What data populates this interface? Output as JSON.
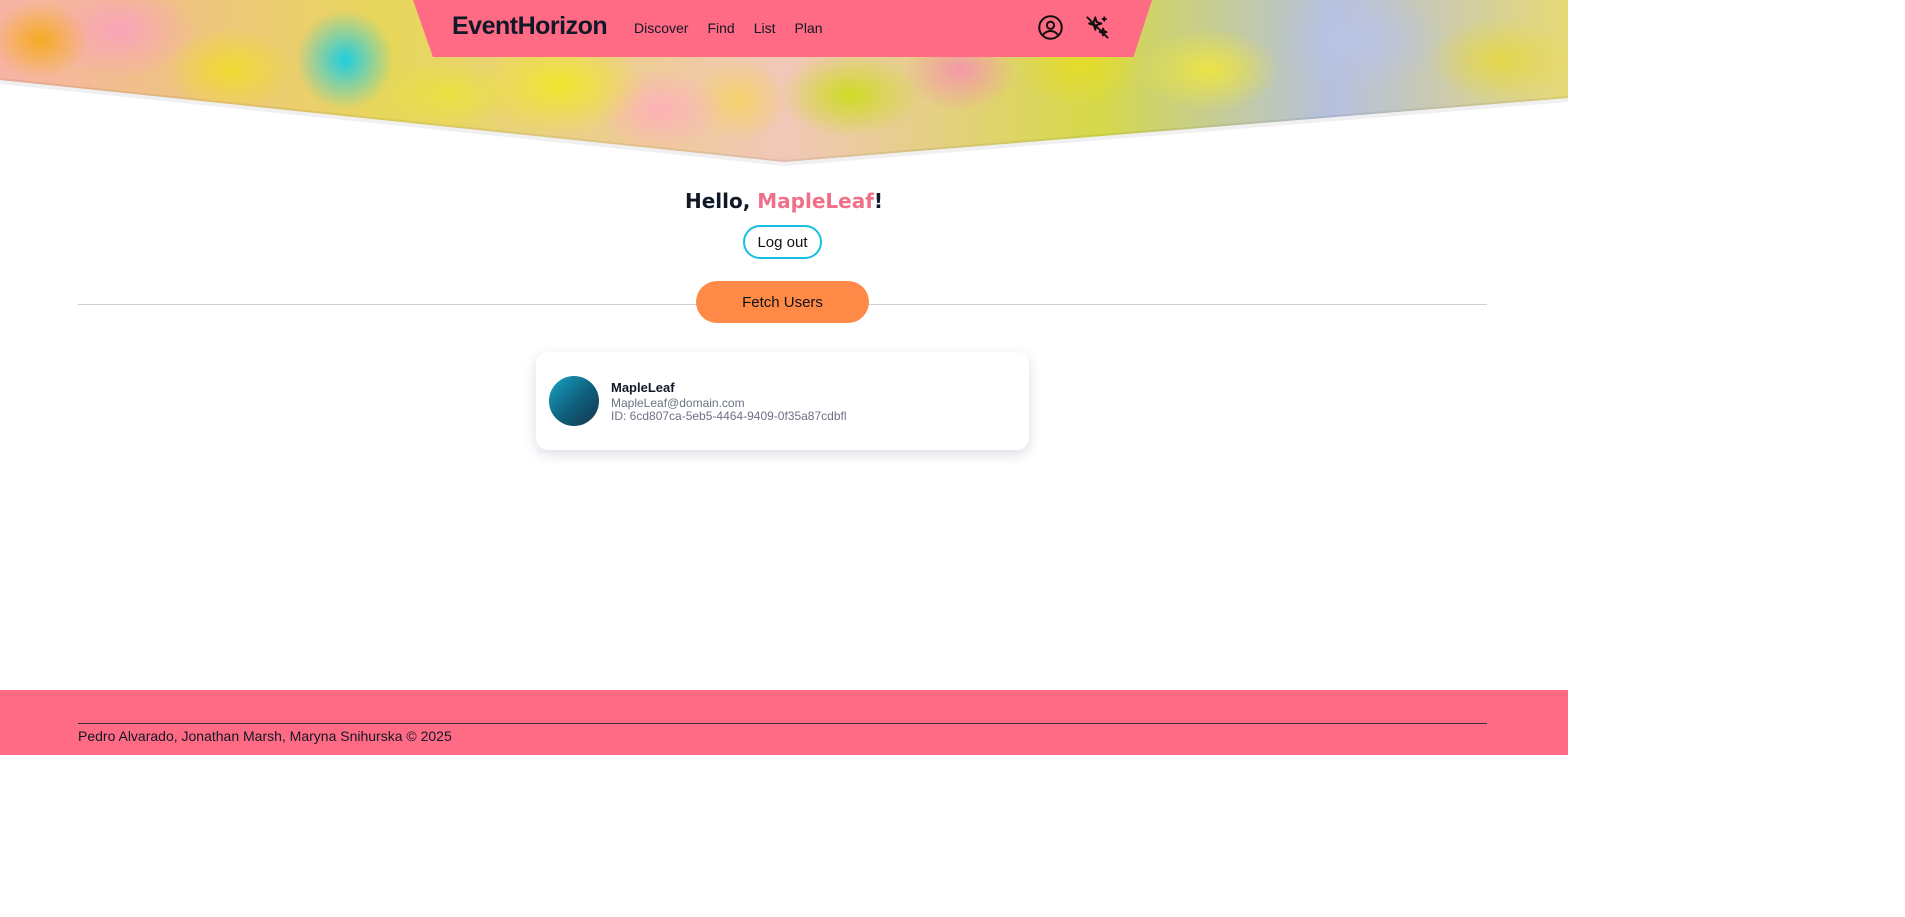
{
  "header": {
    "brand": "EventHorizon",
    "nav_links": [
      "Discover",
      "Find",
      "List",
      "Plan"
    ],
    "icons": [
      "user-circle-icon",
      "sparkles-off-icon"
    ],
    "color": "#ff6b84"
  },
  "main": {
    "greeting_prefix": "Hello, ",
    "username": "MapleLeaf",
    "greeting_suffix": "!",
    "logout_label": "Log out",
    "fetch_label": "Fetch Users",
    "users": [
      {
        "name": "MapleLeaf",
        "email": "MapleLeaf@domain.com",
        "id": "ID: 6cd807ca-5eb5-4464-9409-0f35a87cdbfl"
      }
    ]
  },
  "footer": {
    "text": "Pedro Alvarado, Jonathan Marsh, Maryna Snihurska © 2025"
  },
  "colors": {
    "accent_pink": "#ff6b84",
    "username_pink": "#f0708a",
    "logout_border": "#13c0e3",
    "fetch_button": "#ff8a48"
  }
}
